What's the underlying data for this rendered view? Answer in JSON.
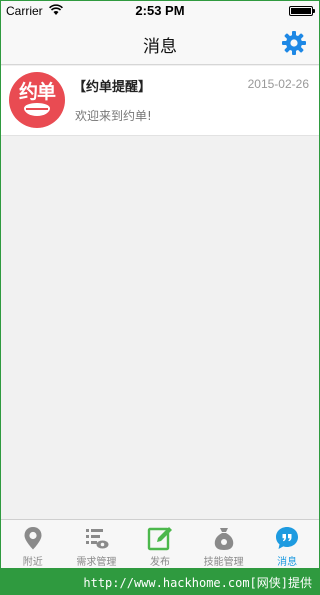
{
  "status_bar": {
    "carrier": "Carrier",
    "time": "2:53 PM",
    "icons": [
      "wifi-icon",
      "battery-icon"
    ]
  },
  "nav_bar": {
    "title": "消息",
    "settings_icon": "gear-icon",
    "accent_color": "#1e88e5"
  },
  "messages": [
    {
      "avatar_text": "约单",
      "title": "【约单提醒】",
      "date": "2015-02-26",
      "preview": "欢迎来到约单!",
      "avatar_color": "#e94b52"
    }
  ],
  "tab_bar": {
    "active_color": "#1e9be0",
    "items": [
      {
        "label": "附近",
        "icon": "location-pin-icon",
        "active": false
      },
      {
        "label": "需求管理",
        "icon": "list-eye-icon",
        "active": false
      },
      {
        "label": "发布",
        "icon": "compose-icon",
        "active": false
      },
      {
        "label": "技能管理",
        "icon": "money-bag-icon",
        "active": false
      },
      {
        "label": "消息",
        "icon": "chat-bubble-icon",
        "active": true
      }
    ]
  },
  "watermark": {
    "text": "http://www.hackhome.com[网侠]提供"
  }
}
